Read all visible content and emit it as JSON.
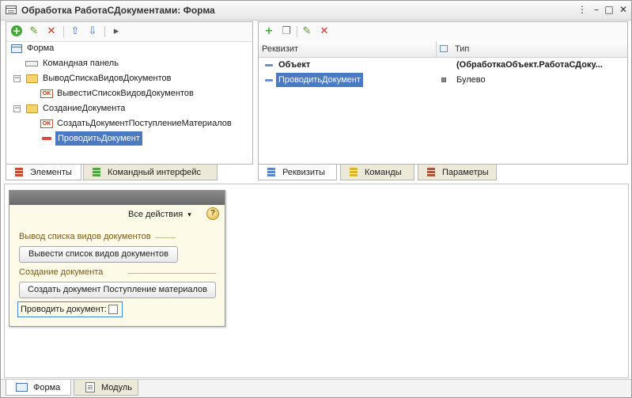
{
  "window": {
    "title": "Обработка РаботаСДокументами: Форма",
    "menu_glyph": "⋮",
    "minimize_glyph": "–",
    "restore_glyph": "□",
    "close_glyph": "✕"
  },
  "left_toolbar": {
    "add_glyph": "+",
    "edit_glyph": "✎",
    "delete_glyph": "✕",
    "up_glyph": "⇧",
    "down_glyph": "⇩",
    "more_glyph": "▸"
  },
  "elements_tree": {
    "root": "Форма",
    "command_panel": "Командная панель",
    "group1": "ВыводСпискаВидовДокументов",
    "group1_button": "ВывестиСписокВидовДокументов",
    "group2": "СозданиеДокумента",
    "group2_button": "СоздатьДокументПоступлениеМатериалов",
    "field": "ПроводитьДокумент",
    "ok_label": "OK",
    "expand_glyph": "−"
  },
  "left_tabs": {
    "elements": "Элементы",
    "command_interface": "Командный интерфейс"
  },
  "right_toolbar": {
    "add_glyph": "+",
    "copy_glyph": "❐",
    "edit_glyph": "✎",
    "delete_glyph": "✕"
  },
  "attributes": {
    "columns": {
      "name": "Реквизит",
      "type": "Тип"
    },
    "rows": [
      {
        "name": "Объект",
        "type": "(ОбработкаОбъект.РаботаСДоку..."
      },
      {
        "name": "ПроводитьДокумент",
        "type": "Булево"
      }
    ]
  },
  "right_tabs": {
    "attributes": "Реквизиты",
    "commands": "Команды",
    "parameters": "Параметры"
  },
  "preview": {
    "all_actions": "Все действия",
    "dropdown_glyph": "▾",
    "help_glyph": "?",
    "group1_title": "Вывод списка видов документов",
    "group1_button": "Вывести список видов документов",
    "group2_title": "Создание документа",
    "group2_button": "Создать документ Поступление материалов",
    "checkbox_label": "Проводить документ:"
  },
  "bottom_tabs": {
    "form": "Форма",
    "module": "Модуль"
  },
  "colors": {
    "selection": "#4b79c3",
    "preview_background": "#fdfbe8",
    "group_title": "#7a5a1a"
  }
}
